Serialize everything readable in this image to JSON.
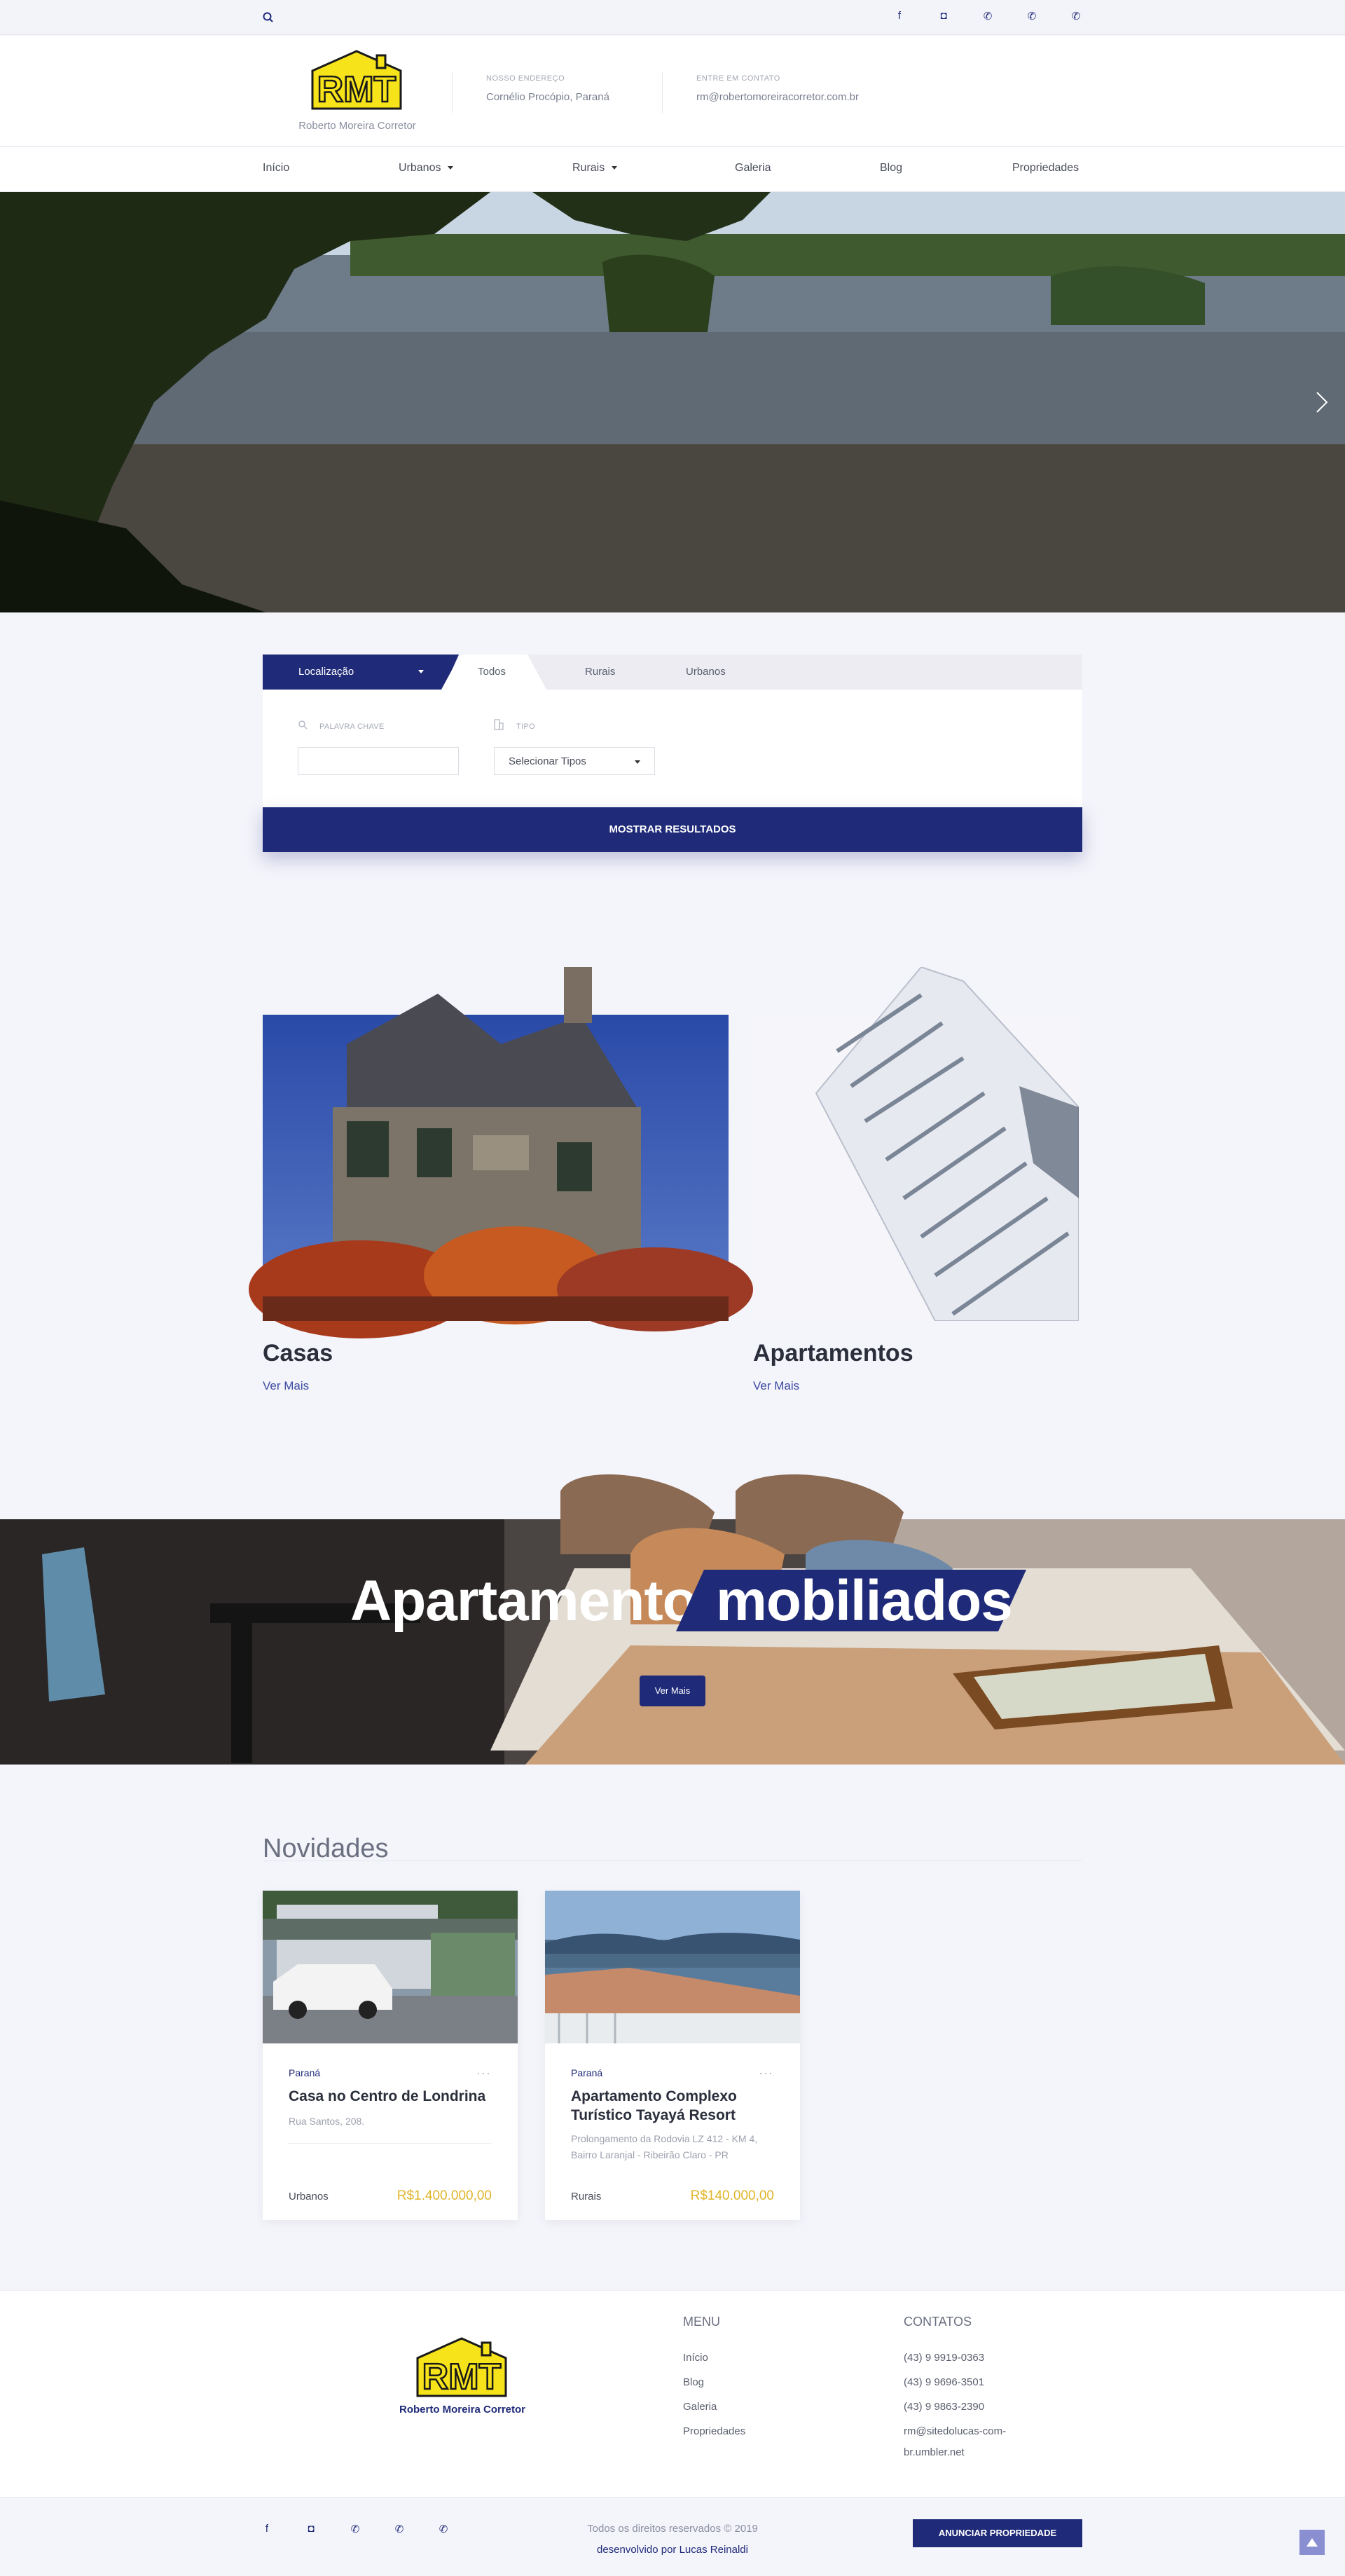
{
  "topbar": {
    "search_icon": "search-icon",
    "social": [
      "facebook-icon",
      "instagram-icon",
      "whatsapp-icon",
      "whatsapp-icon",
      "whatsapp-icon"
    ]
  },
  "header": {
    "logo_text": "RMT",
    "logo_sub": "Roberto Moreira Corretor",
    "address_label": "NOSSO ENDEREÇO",
    "address_value": "Cornélio Procópio, Paraná",
    "contact_label": "ENTRE EM CONTATO",
    "contact_value": "rm@robertomoreiracorretor.com.br"
  },
  "nav": {
    "items": [
      "Início",
      "Urbanos",
      "Rurais",
      "Galeria",
      "Blog",
      "Propriedades"
    ]
  },
  "search": {
    "location_label": "Localização",
    "tabs": [
      "Todos",
      "Rurais",
      "Urbanos"
    ],
    "keyword_label": "PALAVRA CHAVE",
    "type_label": "TIPO",
    "type_select": "Selecionar Tipos",
    "submit": "MOSTRAR RESULTADOS"
  },
  "categories": [
    {
      "title": "Casas",
      "link": "Ver Mais"
    },
    {
      "title": "Apartamentos",
      "link": "Ver Mais"
    }
  ],
  "banner": {
    "title_a": "Apartamentos",
    "title_b": "mobiliados",
    "button": "Ver Mais"
  },
  "news": {
    "title": "Novidades",
    "cards": [
      {
        "state": "Paraná",
        "name": "Casa no Centro de Londrina",
        "address": "Rua Santos, 208.",
        "type": "Urbanos",
        "price": "R$1.400.000,00"
      },
      {
        "state": "Paraná",
        "name": "Apartamento Complexo Turístico Tayayá Resort",
        "address": "Prolongamento da Rodovia LZ 412 - KM 4, Bairro Laranjal - Ribeirão Claro - PR",
        "type": "Rurais",
        "price": "R$140.000,00"
      }
    ]
  },
  "footer": {
    "logo_sub": "Roberto Moreira Corretor",
    "menu_title": "MENU",
    "menu": [
      "Início",
      "Blog",
      "Galeria",
      "Propriedades"
    ],
    "contacts_title": "CONTATOS",
    "contacts": [
      "(43) 9 9919-0363",
      "(43) 9 9696-3501",
      "(43) 9 9863-2390",
      "rm@sitedolucas-com-",
      "br.umbler.net"
    ],
    "copyright": "Todos os direitos reservados © 2019",
    "developer": "desenvolvido por Lucas Reinaldi",
    "cta": "ANUNCIAR PROPRIEDADE"
  },
  "colors": {
    "brand": "#1f2a78",
    "price": "#e0b52a",
    "logo_yellow": "#f7e31a"
  }
}
